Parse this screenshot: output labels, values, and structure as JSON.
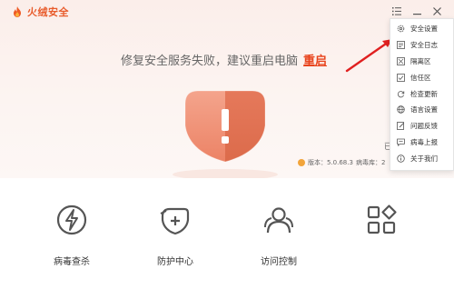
{
  "app": {
    "name": "火绒安全"
  },
  "headline": {
    "text": "修复安全服务失败，建议重启电脑",
    "link": "重启"
  },
  "version": {
    "version_label": "版本：5.0.68.3",
    "virus_db_label": "病毒库：2",
    "side_char": "已"
  },
  "menu": {
    "items": [
      {
        "label": "安全设置",
        "icon": "gear-icon"
      },
      {
        "label": "安全日志",
        "icon": "log-icon"
      },
      {
        "label": "隔离区",
        "icon": "quarantine-icon"
      },
      {
        "label": "信任区",
        "icon": "trust-icon"
      },
      {
        "label": "检查更新",
        "icon": "refresh-icon"
      },
      {
        "label": "语言设置",
        "icon": "globe-icon"
      },
      {
        "label": "问题反馈",
        "icon": "feedback-icon"
      },
      {
        "label": "病毒上报",
        "icon": "report-icon"
      },
      {
        "label": "关于我们",
        "icon": "info-icon"
      }
    ]
  },
  "features": [
    {
      "label": "病毒查杀",
      "icon": "virus-scan-icon"
    },
    {
      "label": "防护中心",
      "icon": "protection-center-icon"
    },
    {
      "label": "访问控制",
      "icon": "access-control-icon"
    },
    {
      "label": "",
      "icon": "more-tools-icon"
    }
  ],
  "colors": {
    "accent": "#e8431c",
    "brand": "#e85a2a",
    "shield": "#e8866a",
    "arrow": "#e02020"
  }
}
